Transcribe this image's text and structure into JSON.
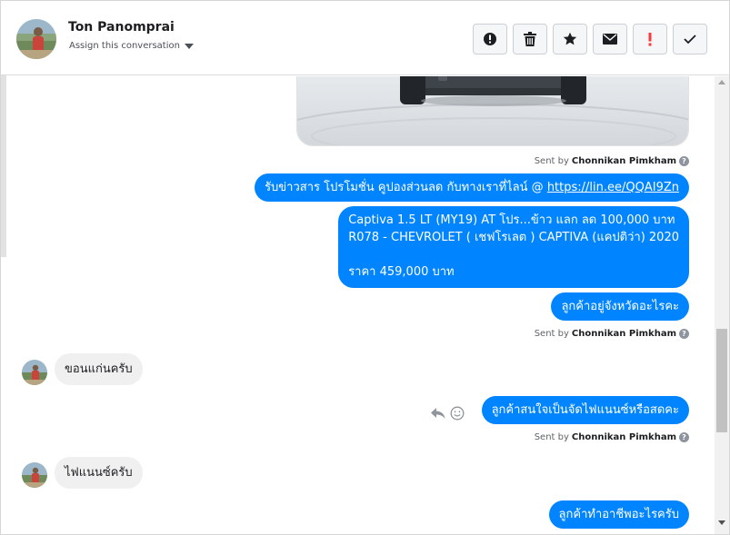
{
  "header": {
    "contact_name": "Ton Panomprai",
    "assign_label": "Assign this conversation",
    "actions": [
      {
        "name": "report-spam-button",
        "icon": "exclamation-circle-icon"
      },
      {
        "name": "delete-button",
        "icon": "trash-icon"
      },
      {
        "name": "star-button",
        "icon": "star-icon"
      },
      {
        "name": "mark-unread-button",
        "icon": "envelope-icon"
      },
      {
        "name": "follow-up-button",
        "icon": "exclamation-icon"
      },
      {
        "name": "mark-done-button",
        "icon": "checkmark-icon"
      }
    ]
  },
  "messages": {
    "sent_by_prefix": "Sent by",
    "agent_name": "Chonnikan Pimkham",
    "promo_text": "รับข่าวสาร โปรโมชั่น คูปองส่วนลด กับทางเราที่ไลน์ @ ",
    "promo_link": "https://lin.ee/QQAI9Zn",
    "car_line1": "Captiva 1.5 LT (MY19) AT โปร...ข้าว แลก ลด 100,000 บาท",
    "car_line2": "R078 - CHEVROLET ( เชฟโรเลต ) CAPTIVA (แคปติว่า) 2020",
    "car_line3": "ราคา 459,000 บาท",
    "q_province": "ลูกค้าอยู่จังหวัดอะไรคะ",
    "a_province": "ขอนแก่นครับ",
    "q_finance": "ลูกค้าสนใจเป็นจัดไฟแนนซ์หรือสดคะ",
    "a_finance": "ไฟแนนซ์ครับ",
    "q_job": "ลูกค้าทำอาชีพอะไรครับ"
  },
  "colors": {
    "outgoing_bubble": "#0084ff",
    "incoming_bubble": "#f1f0f0",
    "link_color": "#ffffff"
  }
}
